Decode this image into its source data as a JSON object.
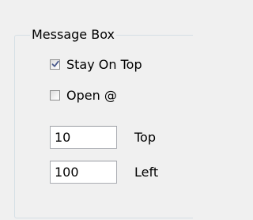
{
  "group": {
    "title": "Message Box"
  },
  "stay_on_top": {
    "label": "Stay On Top",
    "checked": true
  },
  "open_at": {
    "label": "Open @",
    "checked": false
  },
  "top": {
    "value": "10",
    "label": "Top"
  },
  "left": {
    "value": "100",
    "label": "Left"
  },
  "colors": {
    "background": "#f0f0f0",
    "group_border": "#d5dfe5",
    "check_mark": "#4a5a8c",
    "input_border": "#abadb3"
  },
  "icons": {
    "check": "checkmark-icon"
  }
}
